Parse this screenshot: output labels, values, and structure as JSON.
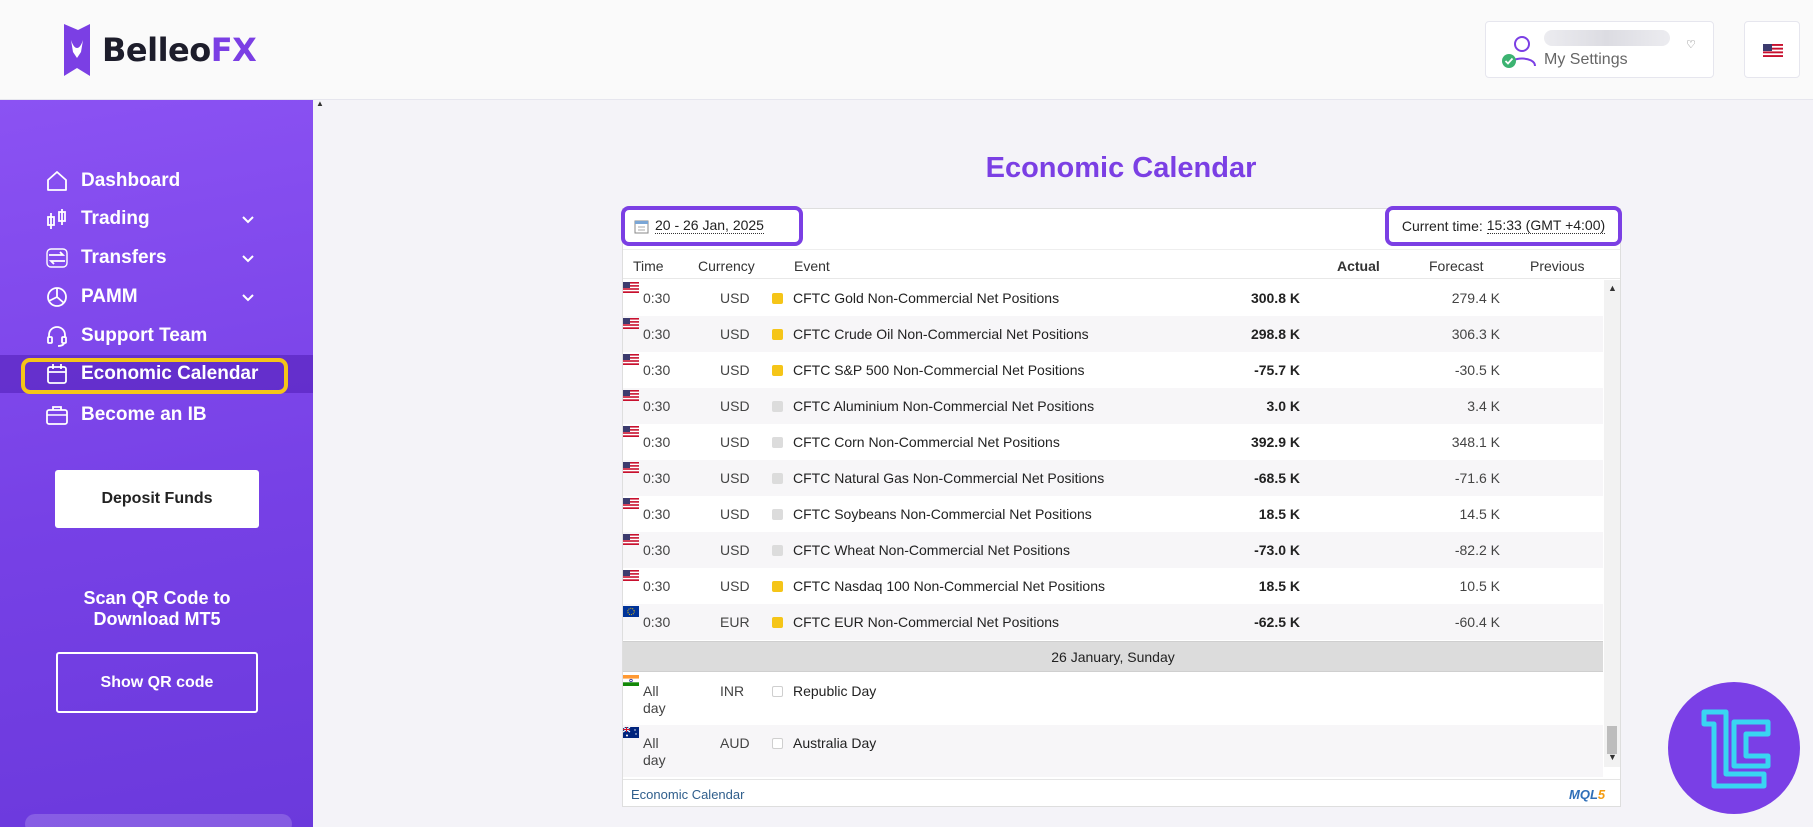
{
  "header": {
    "logo_main": "Belleo",
    "logo_accent": "FX",
    "settings_label": "My Settings"
  },
  "sidebar": {
    "items": [
      {
        "label": "Dashboard"
      },
      {
        "label": "Trading"
      },
      {
        "label": "Transfers"
      },
      {
        "label": "PAMM"
      },
      {
        "label": "Support Team"
      },
      {
        "label": "Economic Calendar"
      },
      {
        "label": "Become an IB"
      }
    ],
    "deposit_label": "Deposit Funds",
    "scan_text": "Scan QR Code to Download MT5",
    "show_qr_label": "Show QR code"
  },
  "main": {
    "title": "Economic Calendar",
    "date_range": "20 - 26 Jan, 2025",
    "current_time_label": "Current time:",
    "current_time_value": "15:33 (GMT +4:00)",
    "columns": {
      "time": "Time",
      "currency": "Currency",
      "event": "Event",
      "actual": "Actual",
      "forecast": "Forecast",
      "previous": "Previous"
    },
    "rows": [
      {
        "time": "0:30",
        "currency": "USD",
        "event": "CFTC Gold Non-Commercial Net Positions",
        "actual": "300.8 K",
        "previous": "279.4 K",
        "importance": "medium"
      },
      {
        "time": "0:30",
        "currency": "USD",
        "event": "CFTC Crude Oil Non-Commercial Net Positions",
        "actual": "298.8 K",
        "previous": "306.3 K",
        "importance": "medium"
      },
      {
        "time": "0:30",
        "currency": "USD",
        "event": "CFTC S&P 500 Non-Commercial Net Positions",
        "actual": "-75.7 K",
        "previous": "-30.5 K",
        "importance": "medium"
      },
      {
        "time": "0:30",
        "currency": "USD",
        "event": "CFTC Aluminium Non-Commercial Net Positions",
        "actual": "3.0 K",
        "previous": "3.4 K",
        "importance": "low"
      },
      {
        "time": "0:30",
        "currency": "USD",
        "event": "CFTC Corn Non-Commercial Net Positions",
        "actual": "392.9 K",
        "previous": "348.1 K",
        "importance": "low"
      },
      {
        "time": "0:30",
        "currency": "USD",
        "event": "CFTC Natural Gas Non-Commercial Net Positions",
        "actual": "-68.5 K",
        "previous": "-71.6 K",
        "importance": "low"
      },
      {
        "time": "0:30",
        "currency": "USD",
        "event": "CFTC Soybeans Non-Commercial Net Positions",
        "actual": "18.5 K",
        "previous": "14.5 K",
        "importance": "low"
      },
      {
        "time": "0:30",
        "currency": "USD",
        "event": "CFTC Wheat Non-Commercial Net Positions",
        "actual": "-73.0 K",
        "previous": "-82.2 K",
        "importance": "low"
      },
      {
        "time": "0:30",
        "currency": "USD",
        "event": "CFTC Nasdaq 100 Non-Commercial Net Positions",
        "actual": "18.5 K",
        "previous": "10.5 K",
        "importance": "medium"
      },
      {
        "time": "0:30",
        "currency": "EUR",
        "event": "CFTC EUR Non-Commercial Net Positions",
        "actual": "-62.5 K",
        "previous": "-60.4 K",
        "importance": "medium"
      }
    ],
    "day_separator": "26 January, Sunday",
    "holidays": [
      {
        "time": "All day",
        "currency": "INR",
        "event": "Republic Day",
        "flag": "in-flag"
      },
      {
        "time": "All day",
        "currency": "AUD",
        "event": "Australia Day",
        "flag": "au-flag"
      }
    ],
    "footer_link": "Economic Calendar",
    "footer_brand": "MQL",
    "footer_brand_num": "5"
  },
  "colors": {
    "accent": "#7b3fe4",
    "highlight": "#f5c518",
    "importance_medium": "#f5c518",
    "importance_low": "#dcdcdc"
  }
}
